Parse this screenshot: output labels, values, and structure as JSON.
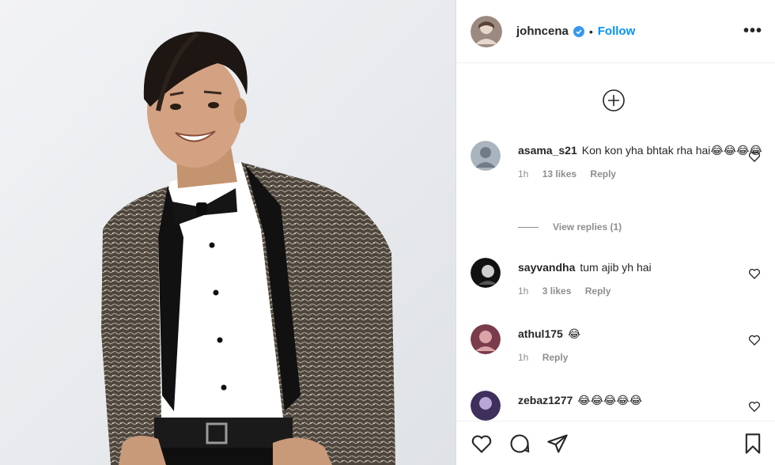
{
  "header": {
    "username": "johncena",
    "separator": "•",
    "follow_label": "Follow",
    "more_label": "•••"
  },
  "comments": [
    {
      "user": "asama_s21",
      "text": "Kon kon yha bhtak rha hai😂😂😂😂",
      "time": "1h",
      "likes": "13 likes",
      "reply": "Reply",
      "view_replies": "View replies (1)"
    },
    {
      "user": "sayvandha",
      "text": "tum ajib yh hai",
      "time": "1h",
      "likes": "3 likes",
      "reply": "Reply"
    },
    {
      "user": "athul175",
      "text": "😂",
      "time": "1h",
      "reply": "Reply"
    },
    {
      "user": "zebaz1277",
      "text": "😂😂😂😂😂"
    }
  ],
  "icons": {
    "load_more": "plus-circle-icon",
    "like": "heart-icon",
    "comment": "comment-icon",
    "share": "share-icon",
    "save": "bookmark-icon"
  },
  "colors": {
    "follow": "#0095f6",
    "verified": "#3897f0",
    "muted": "#8e8e8e",
    "jacket": "#5a5046",
    "background": "#eceff1"
  }
}
